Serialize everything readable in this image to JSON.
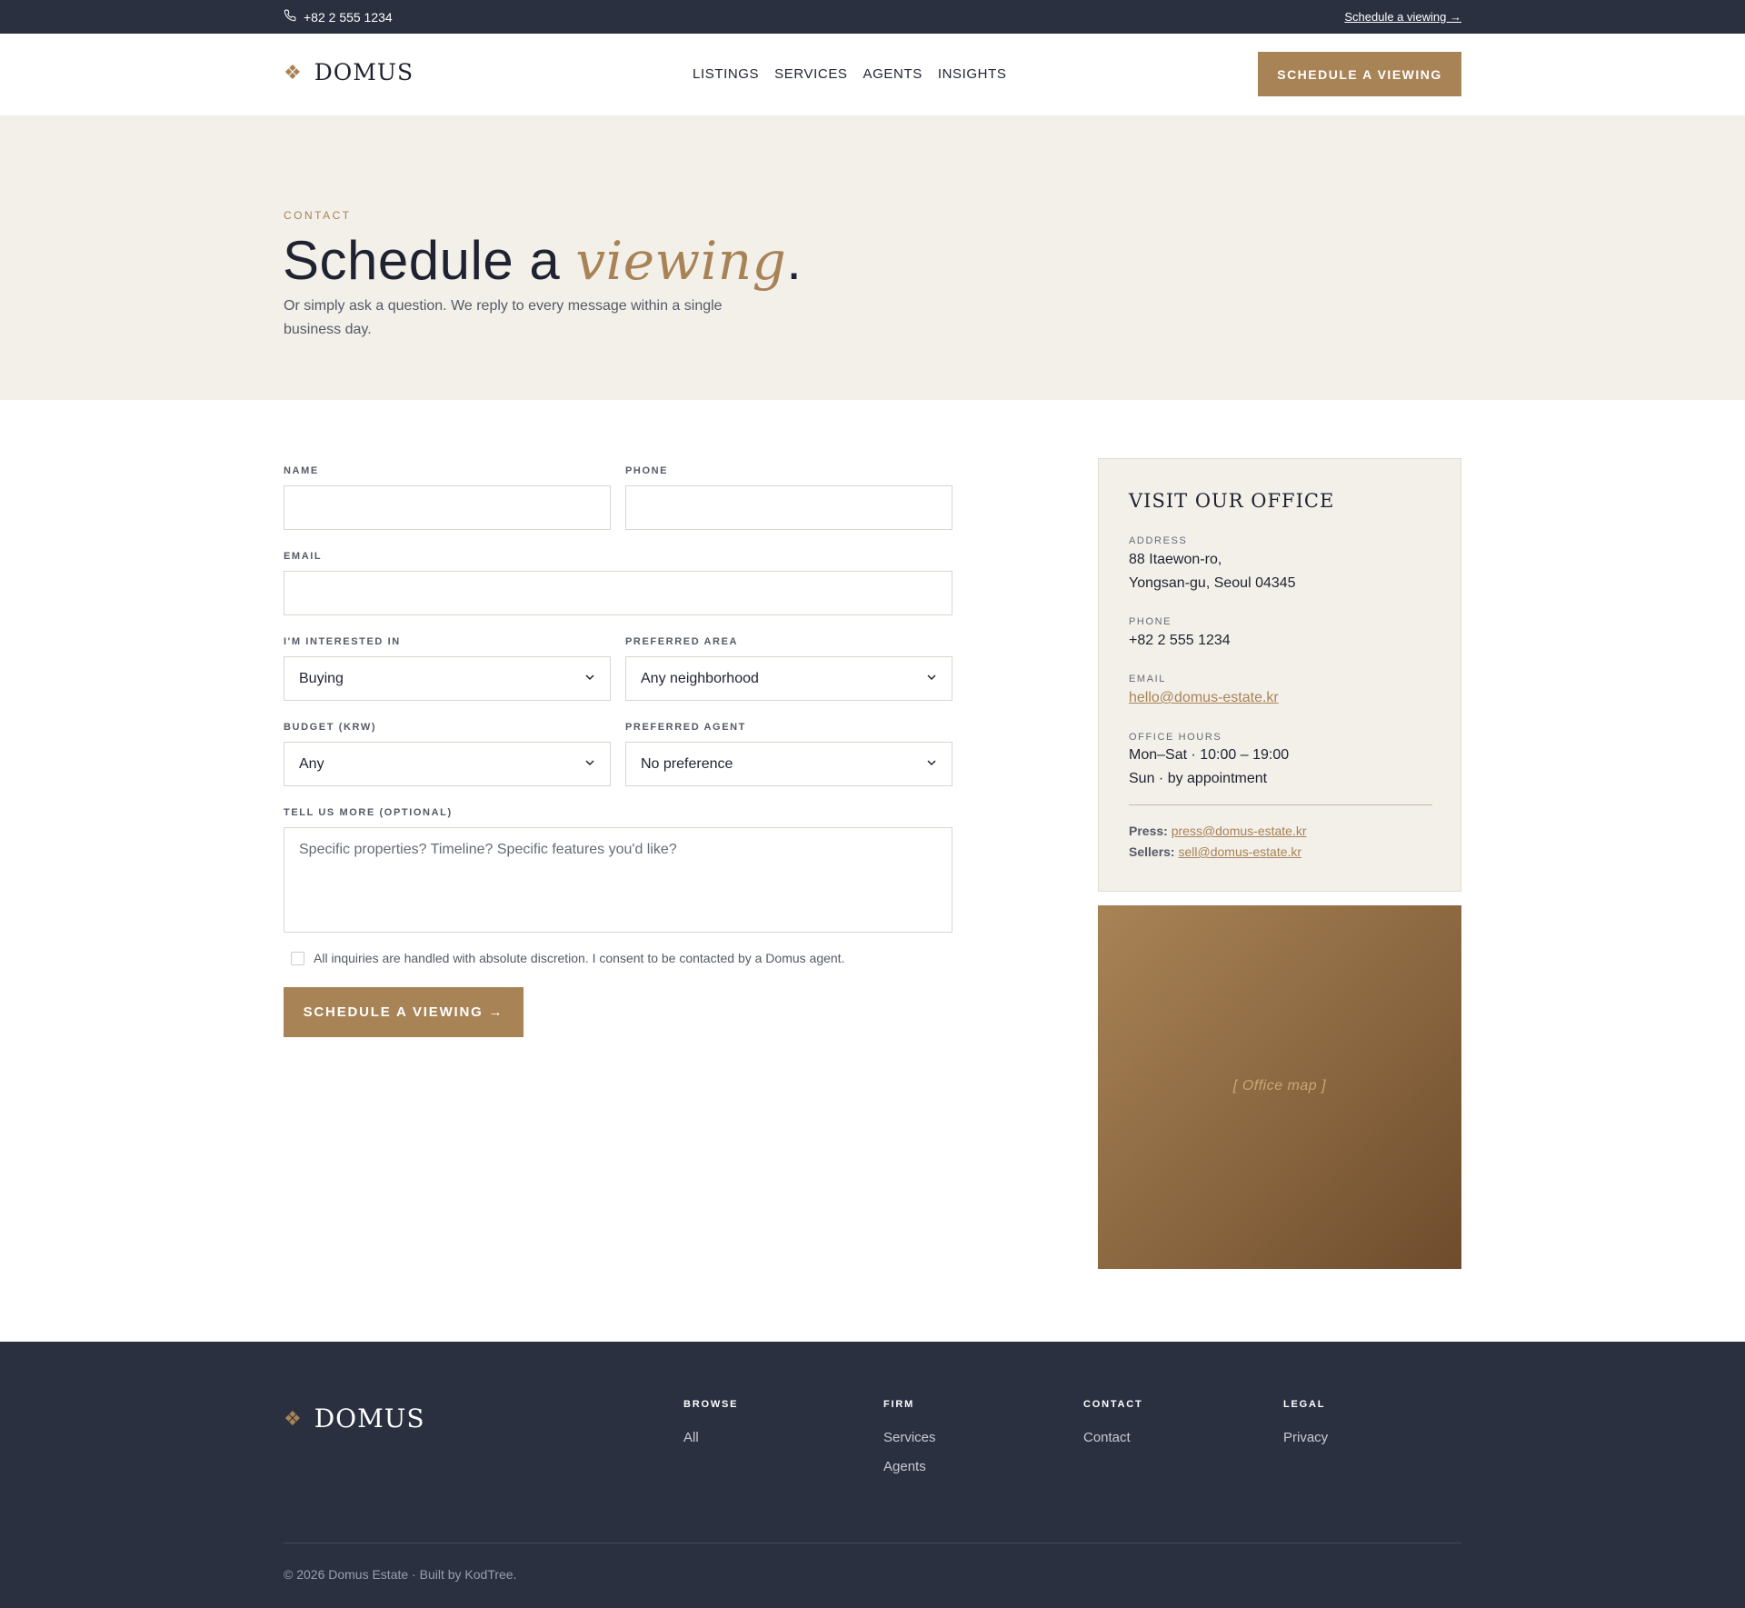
{
  "topbar": {
    "phone": "+82 2 555 1234",
    "schedule_link": "Schedule a viewing →"
  },
  "header": {
    "logo": "DOMUS",
    "nav": [
      "LISTINGS",
      "SERVICES",
      "AGENTS",
      "INSIGHTS"
    ],
    "cta": "SCHEDULE A VIEWING"
  },
  "hero": {
    "eyebrow": "CONTACT",
    "title_start": "Schedule a ",
    "title_em": "viewing",
    "title_end": ".",
    "subtitle": "Or simply ask a question. We reply to every message within a single business day."
  },
  "form": {
    "name_label": "NAME",
    "phone_label": "PHONE",
    "email_label": "EMAIL",
    "interest_label": "I'M INTERESTED IN",
    "interest_value": "Buying",
    "area_label": "PREFERRED AREA",
    "area_value": "Any neighborhood",
    "budget_label": "BUDGET (KRW)",
    "budget_value": "Any",
    "agent_label": "PREFERRED AGENT",
    "agent_value": "No preference",
    "more_label": "TELL US MORE (OPTIONAL)",
    "more_placeholder": "Specific properties? Timeline? Specific features you'd like?",
    "consent": "All inquiries are handled with absolute discretion. I consent to be contacted by a Domus agent.",
    "submit": "SCHEDULE A VIEWING →"
  },
  "office": {
    "title": "VISIT OUR OFFICE",
    "address_label": "ADDRESS",
    "address_line1": "88 Itaewon-ro,",
    "address_line2": "Yongsan-gu, Seoul 04345",
    "phone_label": "PHONE",
    "phone": "+82 2 555 1234",
    "email_label": "EMAIL",
    "email": "hello@domus-estate.kr",
    "hours_label": "OFFICE HOURS",
    "hours_line1": "Mon–Sat · 10:00 – 19:00",
    "hours_line2": "Sun · by appointment",
    "press_label": "Press:",
    "press_email": "press@domus-estate.kr",
    "sellers_label": "Sellers:",
    "sellers_email": "sell@domus-estate.kr",
    "map_label": "[ Office map ]"
  },
  "footer": {
    "logo": "DOMUS",
    "columns": [
      {
        "heading": "BROWSE",
        "links": [
          "All"
        ]
      },
      {
        "heading": "FIRM",
        "links": [
          "Services",
          "Agents"
        ]
      },
      {
        "heading": "CONTACT",
        "links": [
          "Contact"
        ]
      },
      {
        "heading": "LEGAL",
        "links": [
          "Privacy"
        ]
      }
    ],
    "copyright": "© 2026 Domus Estate · Built by KodTree."
  },
  "colors": {
    "accent": "#a88356",
    "dark": "#2b3041",
    "hero_bg": "#f3f0ea"
  }
}
